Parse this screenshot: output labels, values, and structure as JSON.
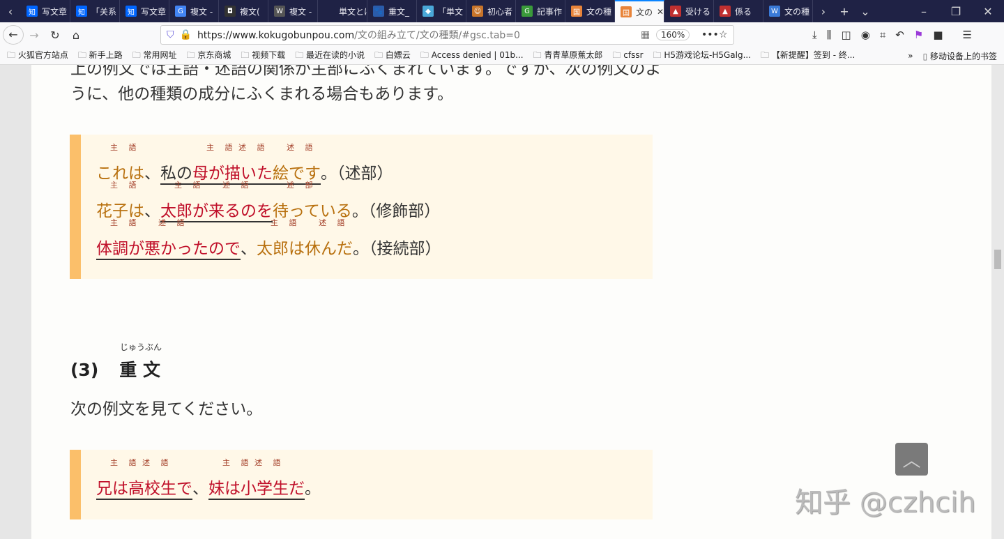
{
  "browser": {
    "tabs": [
      {
        "title": "写文章",
        "icon": "知",
        "color": "#0066ff"
      },
      {
        "title": "「关系",
        "icon": "知",
        "color": "#0066ff"
      },
      {
        "title": "写文章",
        "icon": "知",
        "color": "#0066ff"
      },
      {
        "title": "複文 -",
        "icon": "G",
        "color": "#4285f4"
      },
      {
        "title": "複文(",
        "icon": "◘",
        "color": "#333"
      },
      {
        "title": "複文 -",
        "icon": "W",
        "color": "#555"
      },
      {
        "title": "単文とは",
        "icon": "",
        "color": "#1f2245"
      },
      {
        "title": "重文_",
        "icon": "🐾",
        "color": "#2a5caa"
      },
      {
        "title": "「単文",
        "icon": "◆",
        "color": "#4aa8d8"
      },
      {
        "title": "初心者",
        "icon": "☺",
        "color": "#c8742a"
      },
      {
        "title": "記事作",
        "icon": "G",
        "color": "#3a9a3a"
      },
      {
        "title": "文の種",
        "icon": "国",
        "color": "#e8843a"
      },
      {
        "title": "文の",
        "icon": "国",
        "color": "#e8843a",
        "active": true
      },
      {
        "title": "受ける",
        "icon": "▲",
        "color": "#c03030"
      },
      {
        "title": "係る",
        "icon": "▲",
        "color": "#c03030"
      },
      {
        "title": "文の種",
        "icon": "W",
        "color": "#3a7ad8"
      }
    ],
    "url_host": "https://www.kokugobunpou.com",
    "url_path": "/文の組み立て/文の種類/#gsc.tab=0",
    "zoom": "160%",
    "bookmarks": [
      "火狐官方站点",
      "新手上路",
      "常用网址",
      "京东商城",
      "视频下载",
      "最近在读的小说",
      "白嫖云",
      "Access denied | 01b...",
      "青青草原蕉太郎",
      "cfssr",
      "H5游戏论坛-H5Galg...",
      "【新提醒】签到 - 终...",
      "移动设备上的书签"
    ]
  },
  "content": {
    "partial_line": "上の例文では主語・述語の関係が主部にふくまれています。ですが、次の例文のよ",
    "para1": "うに、他の種類の成分にふくまれる場合もあります。",
    "example1": [
      [
        {
          "u": false,
          "parts": [
            {
              "t": "これは",
              "r": "主 語",
              "c": "brown"
            },
            {
              "t": " 、",
              "c": "black"
            }
          ]
        },
        {
          "u": true,
          "parts": [
            {
              "t": "私の ",
              "c": "black"
            },
            {
              "t": "母が ",
              "r": "主 語",
              "c": "red"
            },
            {
              "t": "描いた ",
              "r": "述 語",
              "c": "red"
            },
            {
              "t": "絵です",
              "r": "述 語",
              "c": "brown"
            }
          ]
        },
        {
          "u": false,
          "parts": [
            {
              "t": " 。（述部）",
              "c": "black"
            }
          ]
        }
      ],
      [
        {
          "u": false,
          "parts": [
            {
              "t": "花子は",
              "r": "主 語",
              "c": "brown"
            },
            {
              "t": " 、",
              "c": "black"
            }
          ]
        },
        {
          "u": true,
          "parts": [
            {
              "t": "太郎が ",
              "r": "主 語",
              "c": "red"
            },
            {
              "t": "来るのを",
              "r": "述 語",
              "c": "red"
            }
          ]
        },
        {
          "u": false,
          "parts": [
            {
              "t": " 待っている",
              "r": "述 部",
              "c": "brown"
            },
            {
              "t": " 。（修飾部）",
              "c": "black"
            }
          ]
        }
      ],
      [
        {
          "u": true,
          "parts": [
            {
              "t": "体調が ",
              "r": "主 語",
              "c": "red"
            },
            {
              "t": "悪かったので",
              "r": "述 語",
              "c": "red"
            }
          ]
        },
        {
          "u": false,
          "parts": [
            {
              "t": " 、",
              "c": "black"
            },
            {
              "t": "太郎は ",
              "r": "主 語",
              "c": "brown"
            },
            {
              "t": "休んだ",
              "r": "述 語",
              "c": "brown"
            },
            {
              "t": " 。（接続部）",
              "c": "black"
            }
          ]
        }
      ]
    ],
    "heading_number": "(3)",
    "heading_title": "重 文",
    "heading_ruby": "じゅうぶん",
    "para2": "次の例文を見てください。",
    "example2": [
      [
        {
          "u": true,
          "parts": [
            {
              "t": "兄は",
              "r": "主 語",
              "c": "red"
            }
          ]
        },
        {
          "u": false,
          "parts": [
            {
              "t": " ",
              "c": "black"
            }
          ]
        },
        {
          "u": true,
          "parts": [
            {
              "t": "高校生で",
              "r": "述 語",
              "c": "red"
            }
          ]
        },
        {
          "u": false,
          "parts": [
            {
              "t": " 、 ",
              "c": "black"
            }
          ]
        },
        {
          "u": true,
          "parts": [
            {
              "t": "妹は",
              "r": "主 語",
              "c": "red"
            }
          ]
        },
        {
          "u": false,
          "parts": [
            {
              "t": " ",
              "c": "black"
            }
          ]
        },
        {
          "u": true,
          "parts": [
            {
              "t": "小学生だ",
              "r": "述 語",
              "c": "red"
            }
          ]
        },
        {
          "u": false,
          "parts": [
            {
              "t": " 。",
              "c": "black"
            }
          ]
        }
      ]
    ],
    "watermark": "知乎 @czhcih"
  },
  "colors": {
    "tabbar": "#1f2245",
    "accent_bar": "#fbbf6a",
    "box_bg": "#fff8e8",
    "red": "#c0102a",
    "brown": "#b8700e"
  }
}
